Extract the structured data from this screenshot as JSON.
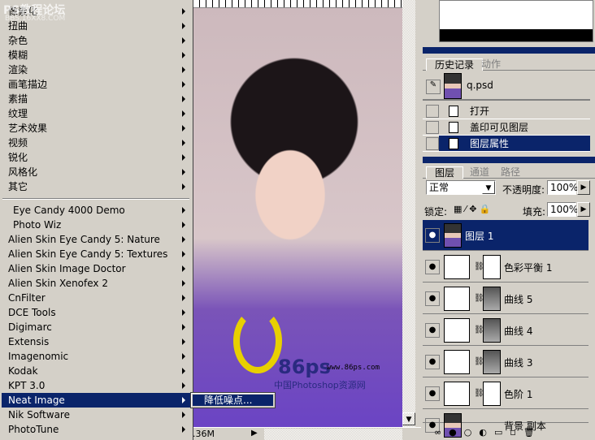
{
  "menu": {
    "group1": [
      "像素化",
      "扭曲",
      "杂色",
      "模糊",
      "渲染",
      "画笔描边",
      "素描",
      "纹理",
      "艺术效果",
      "视频",
      "锐化",
      "风格化",
      "其它"
    ],
    "group2": [
      "Eye Candy 4000 Demo",
      "Photo Wiz",
      "Alien Skin Eye Candy 5: Nature",
      "Alien Skin Eye Candy 5: Textures",
      "Alien Skin Image Doctor",
      "Alien Skin Xenofex 2",
      "CnFilter",
      "DCE Tools",
      "Digimarc",
      "Extensis",
      "Imagenomic",
      "Kodak",
      "KPT 3.0",
      "Neat Image",
      "Nik Software",
      "PhotoTune"
    ],
    "selected": "Neat Image",
    "submenu": "降低噪点..."
  },
  "watermark": {
    "title": "PS教程论坛",
    "url": "BBS.16XX8.COM"
  },
  "canvas": {
    "logo_text": "86ps",
    "logo_url": "www.86ps.com",
    "logo_sub": "中国Photoshop资源网"
  },
  "status": {
    "doc_size": ".36M"
  },
  "history": {
    "tabs": [
      "历史记录",
      "动作"
    ],
    "snapshot": "q.psd",
    "items": [
      "打开",
      "盖印可见图层",
      "图层属性"
    ],
    "selected": "图层属性"
  },
  "layers": {
    "tabs": [
      "图层",
      "通道",
      "路径"
    ],
    "blend_mode": "正常",
    "opacity_label": "不透明度:",
    "opacity": "100%",
    "lock_label": "锁定:",
    "fill_label": "填充:",
    "fill": "100%",
    "items": [
      {
        "name": "图层 1",
        "selected": true
      },
      {
        "name": "色彩平衡 1"
      },
      {
        "name": "曲线 5"
      },
      {
        "name": "曲线 4"
      },
      {
        "name": "曲线 3"
      },
      {
        "name": "色阶 1"
      },
      {
        "name": "背景 副本"
      }
    ]
  },
  "colors": {
    "highlight": "#0a246a",
    "panel": "#d4d0c8"
  }
}
